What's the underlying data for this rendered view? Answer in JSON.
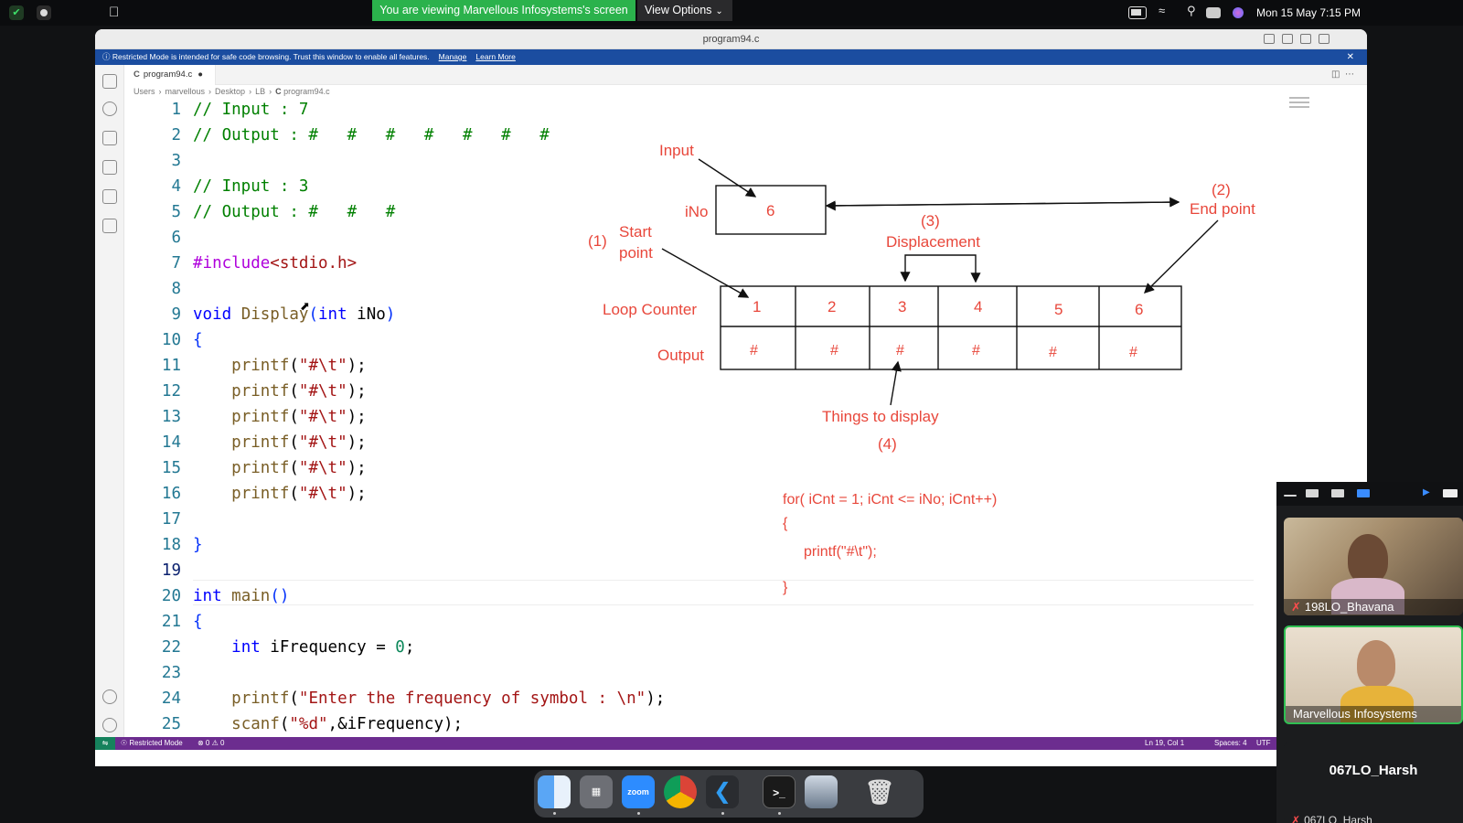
{
  "menubar": {
    "share_banner": "You are viewing Marvellous Infosystems's screen",
    "view_options": "View Options",
    "clock": "Mon 15 May  7:15 PM"
  },
  "window": {
    "title": "program94.c",
    "restricted_msg": "Restricted Mode is intended for safe code browsing. Trust this window to enable all features.",
    "manage_link": "Manage",
    "learn_more_link": "Learn More",
    "tab_label": "program94.c",
    "tab_lang": "C",
    "breadcrumb": [
      "Users",
      "marvellous",
      "Desktop",
      "LB",
      "program94.c"
    ]
  },
  "editor": {
    "line_numbers": [
      "1",
      "2",
      "3",
      "4",
      "5",
      "6",
      "7",
      "8",
      "9",
      "10",
      "11",
      "12",
      "13",
      "14",
      "15",
      "16",
      "17",
      "18",
      "19",
      "20",
      "21",
      "22",
      "23",
      "24",
      "25"
    ],
    "active_line": 19
  },
  "annotation": {
    "input_label": "Input",
    "ino_label": "iNo",
    "ino_value": "6",
    "end_label_num": "(2)",
    "end_label": "End point",
    "displacement_num": "(3)",
    "displacement_label": "Displacement",
    "start_num": "(1)",
    "start_label_1": "Start",
    "start_label_2": "point",
    "loop_counter_label": "Loop Counter",
    "output_label": "Output",
    "counters": [
      "1",
      "2",
      "3",
      "4",
      "5",
      "6"
    ],
    "outputs": [
      "#",
      "#",
      "#",
      "#",
      "#",
      "#"
    ],
    "things_label": "Things to display",
    "things_num": "(4)",
    "loop_line1": "for( iCnt = 1; iCnt <= iNo; iCnt++)",
    "loop_line2": "{",
    "loop_line3": "printf(\"#\\t\");",
    "loop_line4": "}"
  },
  "statusbar": {
    "mode": "Restricted Mode",
    "problems": "⊗ 0 ⚠ 0",
    "position": "Ln 19, Col 1",
    "spaces": "Spaces: 4",
    "encoding": "UTF"
  },
  "dock": {
    "zoom_label": "zoom"
  },
  "participants": [
    {
      "name": "198LO_Bhavana",
      "muted": true
    },
    {
      "name": "Marvellous Infosystems",
      "muted": false
    },
    {
      "name": "067LO_Harsh",
      "sub": "067LO_Harsh"
    }
  ]
}
